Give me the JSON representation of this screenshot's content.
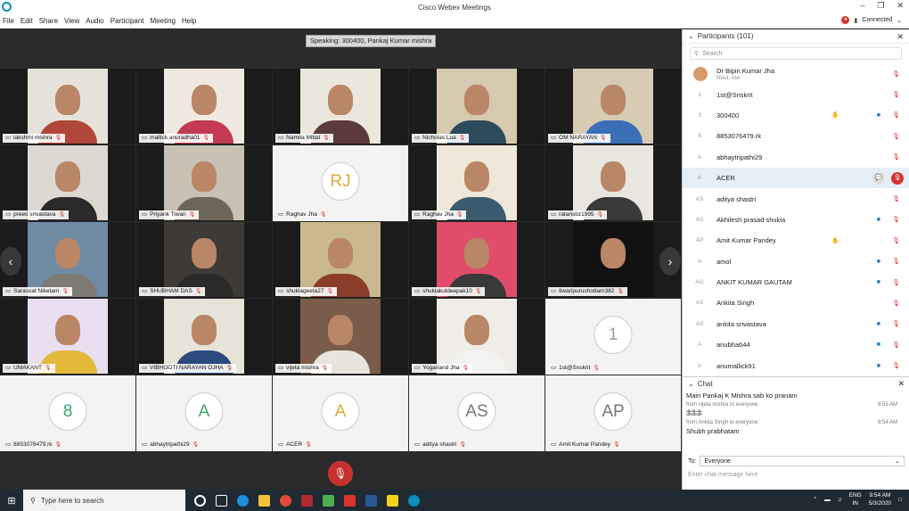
{
  "window": {
    "title": "Cisco Webex Meetings",
    "status": "Connected"
  },
  "menu": [
    "File",
    "Edit",
    "Share",
    "View",
    "Audio",
    "Participant",
    "Meeting",
    "Help"
  ],
  "stage": {
    "speaking": "Speaking: 300400, Pankaj Kumar mishra"
  },
  "tiles": [
    {
      "name": "lakshmi mishra",
      "type": "video",
      "shirt": "#b0473a",
      "bg": "#e6e2da"
    },
    {
      "name": "mallick.anuradha01",
      "type": "video",
      "shirt": "#c43a52",
      "bg": "#efe9e2"
    },
    {
      "name": "Namita Mittal",
      "type": "video",
      "shirt": "#5a3a3a",
      "bg": "#ece7dc"
    },
    {
      "name": "Nicholas Lua",
      "type": "video",
      "shirt": "#2e4a5d",
      "bg": "#d7c8b0"
    },
    {
      "name": "OM NARAYAN",
      "type": "video",
      "shirt": "#3a6fb8",
      "bg": "#d8cbb4"
    },
    {
      "name": "preeti srivastava",
      "type": "video",
      "shirt": "#2a2a2a",
      "bg": "#ddd8d2"
    },
    {
      "name": "Priyank Tiwari",
      "type": "video",
      "shirt": "#6f665a",
      "bg": "#c9c2b4"
    },
    {
      "name": "Raghav Jha",
      "type": "avatar",
      "initials": "RJ",
      "color": "#e0a83a"
    },
    {
      "name": "Raghav Jha",
      "type": "video",
      "shirt": "#3a5c6e",
      "bg": "#efe8da"
    },
    {
      "name": "ratansbz1995",
      "type": "video",
      "shirt": "#3a3a3a",
      "bg": "#e9e5df"
    },
    {
      "name": "Sarasvat Niketam",
      "type": "video",
      "shirt": "#7e7a74",
      "bg": "#6f8aa3"
    },
    {
      "name": "SHUBHAM DAS",
      "type": "video",
      "shirt": "#2a2a2a",
      "bg": "#3e3b36"
    },
    {
      "name": "shuklageeta27",
      "type": "video",
      "shirt": "#8b3d2c",
      "bg": "#c9b98c"
    },
    {
      "name": "shuklakuldeepak10",
      "type": "video",
      "shirt": "#3a3a3a",
      "bg": "#e04c6a"
    },
    {
      "name": "tiwaripurushottam382",
      "type": "video",
      "shirt": "#111",
      "bg": "#111111"
    },
    {
      "name": "UMAKANT",
      "type": "video",
      "shirt": "#e3b93a",
      "bg": "#e9dff0"
    },
    {
      "name": "VIBHOOTI NARAYAN OJHA",
      "type": "video",
      "shirt": "#2c4a7e",
      "bg": "#e7e3d8"
    },
    {
      "name": "vijeta mishra",
      "type": "video",
      "shirt": "#e8e4de",
      "bg": "#7a5c4a"
    },
    {
      "name": "Yoganand Jha",
      "type": "video",
      "shirt": "#f2f2f2",
      "bg": "#f0ede8"
    },
    {
      "name": "1st@Snskrit",
      "type": "avatar",
      "initials": "1",
      "color": "#999999"
    },
    {
      "name": "8853076479.rk",
      "type": "avatar",
      "initials": "8",
      "color": "#3aa86f"
    },
    {
      "name": "abhaytripathi29",
      "type": "avatar",
      "initials": "A",
      "color": "#3aa86f"
    },
    {
      "name": "ACER",
      "type": "avatar",
      "initials": "A",
      "color": "#e0a83a"
    },
    {
      "name": "aditya shastri",
      "type": "avatar",
      "initials": "AS",
      "color": "#777777"
    },
    {
      "name": "Amit Kumar Pandey",
      "type": "avatar",
      "initials": "AP",
      "color": "#777777"
    }
  ],
  "participants": {
    "header": "Participants (101)",
    "search_placeholder": "Search",
    "host": {
      "name": "Dr Bipin Kumar Jha",
      "role": "Host, me"
    },
    "list": [
      {
        "initials": "1",
        "name": "1st@Snskrit",
        "cam": false,
        "hand": false
      },
      {
        "initials": "3",
        "name": "300400",
        "cam": true,
        "hand": true
      },
      {
        "initials": "8",
        "name": "8853076479.rk",
        "cam": false,
        "hand": false
      },
      {
        "initials": "A",
        "name": "abhaytripathi29",
        "cam": false,
        "hand": false
      },
      {
        "initials": "A",
        "name": "ACER",
        "cam": false,
        "hand": false,
        "selected": true
      },
      {
        "initials": "AS",
        "name": "aditya shastri",
        "cam": false,
        "hand": false
      },
      {
        "initials": "AS",
        "name": "Akhilesh prasad shukla",
        "cam": true,
        "hand": false
      },
      {
        "initials": "AP",
        "name": "Amit Kumar Pandey",
        "cam": false,
        "hand": true
      },
      {
        "initials": "A",
        "name": "amol",
        "cam": true,
        "hand": false
      },
      {
        "initials": "AG",
        "name": "ANKIT KUMAR GAUTAM",
        "cam": true,
        "hand": false
      },
      {
        "initials": "AS",
        "name": "Ankita Singh",
        "cam": false,
        "hand": false
      },
      {
        "initials": "AS",
        "name": "ankita srivastava",
        "cam": true,
        "hand": false
      },
      {
        "initials": "A",
        "name": "anubha644",
        "cam": true,
        "hand": false
      },
      {
        "initials": "A",
        "name": "anumallick91",
        "cam": true,
        "hand": false
      }
    ]
  },
  "chat": {
    "header": "Chat",
    "messages": [
      {
        "text": "Main Pankaj K Mishra sab ko pranam",
        "from": "",
        "time": ""
      },
      {
        "text": "ऊँऊँऊँ",
        "from": "from vijeta mishra to everyone:",
        "time": "9:53 AM"
      },
      {
        "text": "Shubh prabhatam",
        "from": "from Ankita Singh to everyone:",
        "time": "9:54 AM"
      }
    ],
    "to_label": "To:",
    "to_value": "Everyone",
    "input_placeholder": "Enter chat message here"
  },
  "taskbar": {
    "search_placeholder": "Type here to search",
    "lang": "ENG",
    "region": "IN",
    "time": "9:54 AM",
    "date": "5/3/2020"
  }
}
